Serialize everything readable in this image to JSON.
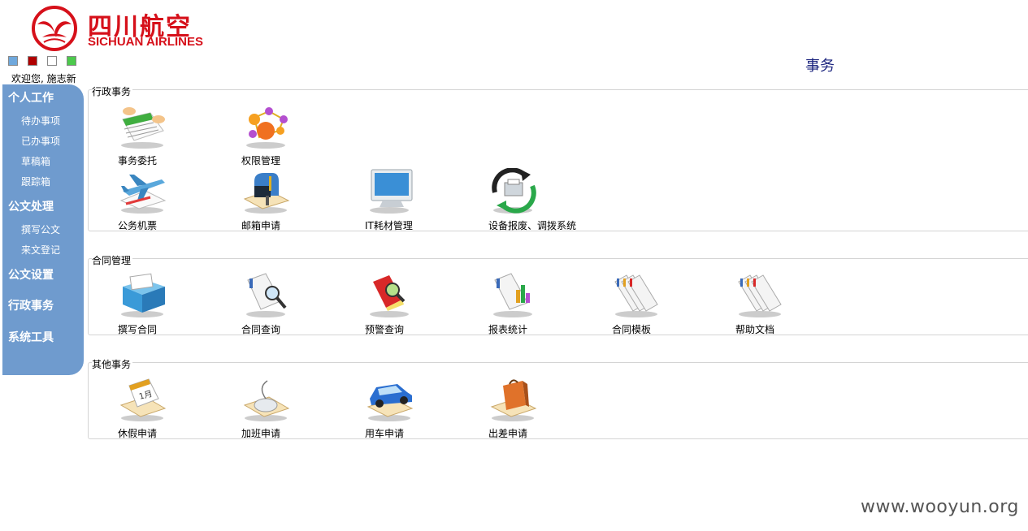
{
  "header": {
    "logo_chinese": "四川航空",
    "logo_english": "SICHUAN AIRLINES",
    "welcome": "欢迎您, 施志新",
    "page_title": "事务"
  },
  "theme_swatches": [
    "#6fa8dc",
    "#b00000",
    "#ffffff",
    "#4cc94c"
  ],
  "sidebar": {
    "personal_work": "个人工作",
    "todo": "待办事项",
    "done": "已办事项",
    "drafts": "草稿箱",
    "tracking": "跟踪箱",
    "document_processing": "公文处理",
    "write_document": "撰写公文",
    "incoming_register": "来文登记",
    "document_settings": "公文设置",
    "admin_affairs": "行政事务",
    "system_tools": "系统工具"
  },
  "admin_group": {
    "title": "行政事务",
    "delegate": "事务委托",
    "permission": "权限管理",
    "ticket": "公务机票",
    "mailbox": "邮箱申请",
    "it_supplies": "IT耗材管理",
    "equipment": "设备报废、调拨系统"
  },
  "contract_group": {
    "title": "合同管理",
    "write_contract": "撰写合同",
    "contract_query": "合同查询",
    "alert_query": "预警查询",
    "report_stats": "报表统计",
    "contract_template": "合同模板",
    "help_docs": "帮助文档"
  },
  "other_group": {
    "title": "其他事务",
    "leave": "休假申请",
    "overtime": "加班申请",
    "vehicle": "用车申请",
    "business_trip": "出差申请"
  },
  "watermark": "www.wooyun.org"
}
